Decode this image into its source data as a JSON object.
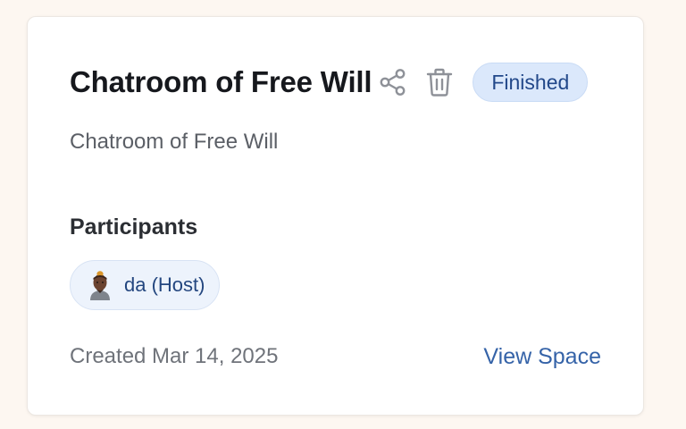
{
  "space": {
    "title": "Chatroom of Free Will",
    "status": "Finished",
    "description": "Chatroom of Free Will",
    "created": "Created Mar 14, 2025",
    "view_link": "View Space",
    "actions": {
      "share_icon": "share-icon",
      "delete_icon": "trash-icon"
    }
  },
  "participants": {
    "label": "Participants",
    "items": [
      {
        "name": "da (Host)",
        "avatar": "avatar-icon"
      }
    ]
  },
  "colors": {
    "badge_bg": "#dbe8fb",
    "badge_text": "#22488a",
    "link": "#3563a8",
    "chip_bg": "#edf3fc"
  }
}
